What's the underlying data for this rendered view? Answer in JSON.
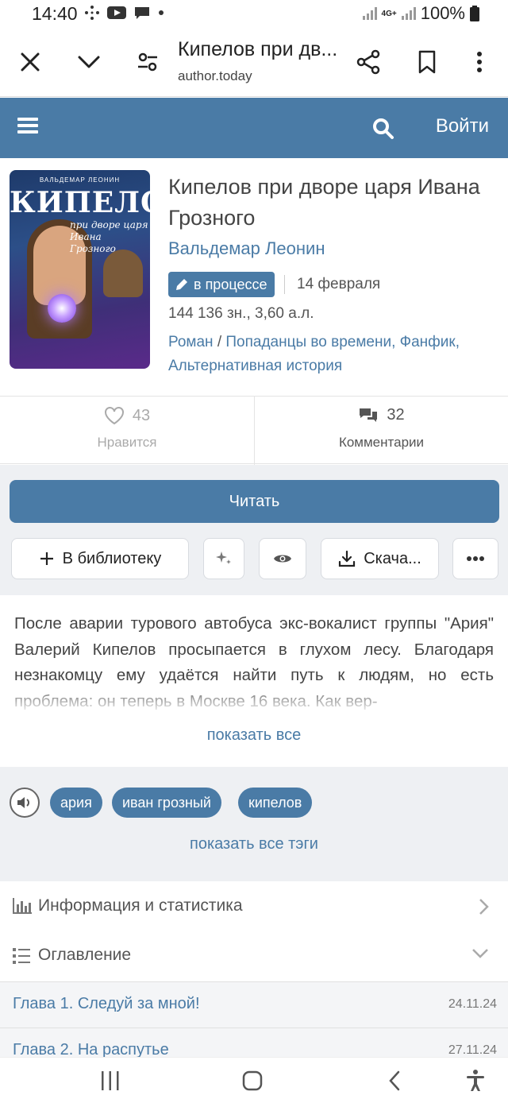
{
  "status_bar": {
    "time": "14:40",
    "network": "4G+",
    "battery": "100%"
  },
  "browser": {
    "title": "Кипелов при дв...",
    "url": "author.today"
  },
  "site_header": {
    "login_label": "Войти"
  },
  "book": {
    "cover": {
      "author": "ВАЛЬДЕМАР ЛЕОНИН",
      "title": "КИПЕЛОВ",
      "subtitle_line1": "при дворе царя",
      "subtitle_line2": "Ивана Грозного"
    },
    "title": "Кипелов при дворе царя Ивана Грозного",
    "author": "Вальдемар Леонин",
    "status": "в процессе",
    "date": "14 февраля",
    "size": "144 136 зн., 3,60 а.л.",
    "genre_primary": "Роман",
    "genre_secondary": "Попаданцы во времени, Фанфик, Альтернативная история"
  },
  "stats": {
    "likes_count": "43",
    "likes_label": "Нравится",
    "comments_count": "32",
    "comments_label": "Комментарии"
  },
  "actions": {
    "read_label": "Читать",
    "library_label": "В библиотеку",
    "download_label": "Скача..."
  },
  "annotation": {
    "text": "После аварии турового автобуса экс-вокалист группы \"Ария\" Валерий Кипелов просыпается в глухом лесу. Благодаря незнакомцу ему удаётся найти путь к людям, но есть проблема: он теперь в Москве 16 века. Как вер-",
    "show_all": "показать все"
  },
  "tags": {
    "items": [
      "ария",
      "иван грозный",
      "кипелов"
    ],
    "show_all": "показать все тэги"
  },
  "sections": {
    "info": "Информация и статистика",
    "toc": "Оглавление"
  },
  "chapters": [
    {
      "title": "Глава 1. Следуй за мной!",
      "date": "24.11.24"
    },
    {
      "title": "Глава 2. На распутье",
      "date": "27.11.24"
    }
  ],
  "colors": {
    "brand": "#4a7ba6",
    "panel_bg": "#eef0f3"
  }
}
